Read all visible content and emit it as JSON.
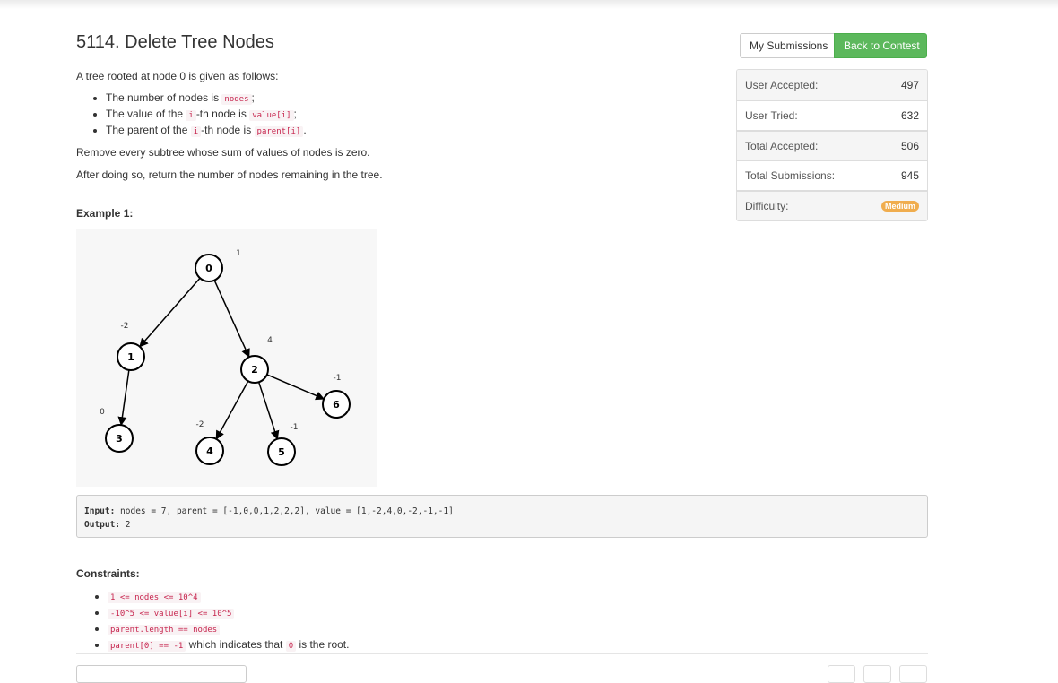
{
  "problem": {
    "title": "5114. Delete Tree Nodes",
    "intro": "A tree rooted at node 0 is given as follows:",
    "bullets": [
      {
        "a": "The number of nodes is ",
        "code1": "nodes",
        "b": ";"
      },
      {
        "a": "The value of the ",
        "code1": "i",
        "b": "-th node is ",
        "code2": "value[i]",
        "c": ";"
      },
      {
        "a": "The parent of the ",
        "code1": "i",
        "b": "-th node is ",
        "code2": "parent[i]",
        "c": "."
      }
    ],
    "p_remove": "Remove every subtree whose sum of values of nodes is zero.",
    "p_return": "After doing so, return the number of nodes remaining in the tree."
  },
  "example": {
    "heading": "Example 1:",
    "tree": {
      "nodes": [
        {
          "id": "0",
          "value": "1"
        },
        {
          "id": "1",
          "value": "-2"
        },
        {
          "id": "2",
          "value": "4"
        },
        {
          "id": "3",
          "value": "0"
        },
        {
          "id": "4",
          "value": "-2"
        },
        {
          "id": "5",
          "value": "-1"
        },
        {
          "id": "6",
          "value": "-1"
        }
      ]
    },
    "input_label": "Input:",
    "input_value": " nodes = 7, parent = [-1,0,0,1,2,2,2], value = [1,-2,4,0,-2,-1,-1]",
    "output_label": "Output:",
    "output_value": " 2"
  },
  "constraints": {
    "heading": "Constraints:",
    "items": [
      {
        "code": "1 <= nodes <= 10^4"
      },
      {
        "code": "-10^5 <= value[i] <= 10^5"
      },
      {
        "code": "parent.length == nodes"
      },
      {
        "code": "parent[0] == -1",
        "text1": " which indicates that ",
        "code2": "0",
        "text2": " is the root."
      }
    ]
  },
  "sidebar": {
    "my_submissions": "My Submissions",
    "back_to_contest": "Back to Contest",
    "stats": [
      {
        "label": "User Accepted:",
        "value": "497"
      },
      {
        "label": "User Tried:",
        "value": "632"
      },
      {
        "label": "Total Accepted:",
        "value": "506"
      },
      {
        "label": "Total Submissions:",
        "value": "945"
      },
      {
        "label": "Difficulty:",
        "value": "Medium"
      }
    ],
    "accent_green": "#5cb85c",
    "difficulty_color": "#f0ad4e"
  }
}
